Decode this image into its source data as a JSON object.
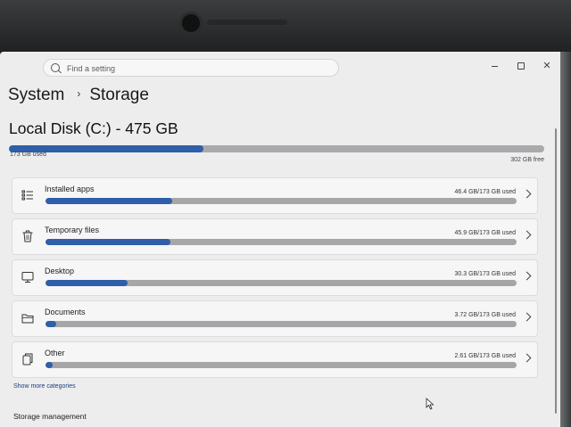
{
  "window": {
    "search_placeholder": "Find a setting",
    "controls": {
      "minimize": "—",
      "maximize": "▢",
      "close": "✕"
    }
  },
  "breadcrumb": {
    "parent": "System",
    "current": "Storage"
  },
  "disk": {
    "title": "Local Disk (C:) - 475 GB",
    "used_label": "173 GB used",
    "free_label": "302 GB free",
    "used_fraction": 0.364
  },
  "categories": [
    {
      "label": "Installed apps",
      "size": "46.4 GB/173 GB used",
      "fraction": 0.268,
      "icon": "apps-list-icon"
    },
    {
      "label": "Temporary files",
      "size": "45.9 GB/173 GB used",
      "fraction": 0.265,
      "icon": "trash-icon"
    },
    {
      "label": "Desktop",
      "size": "30.3 GB/173 GB used",
      "fraction": 0.175,
      "icon": "monitor-icon"
    },
    {
      "label": "Documents",
      "size": "3.72 GB/173 GB used",
      "fraction": 0.022,
      "icon": "folder-icon"
    },
    {
      "label": "Other",
      "size": "2.61 GB/173 GB used",
      "fraction": 0.015,
      "icon": "other-files-icon"
    }
  ],
  "show_more": "Show more categories",
  "storage_management": {
    "heading": "Storage management"
  },
  "colors": {
    "accent": "#2e5fa8",
    "track": "#a6a6a9",
    "background": "#ededee"
  }
}
